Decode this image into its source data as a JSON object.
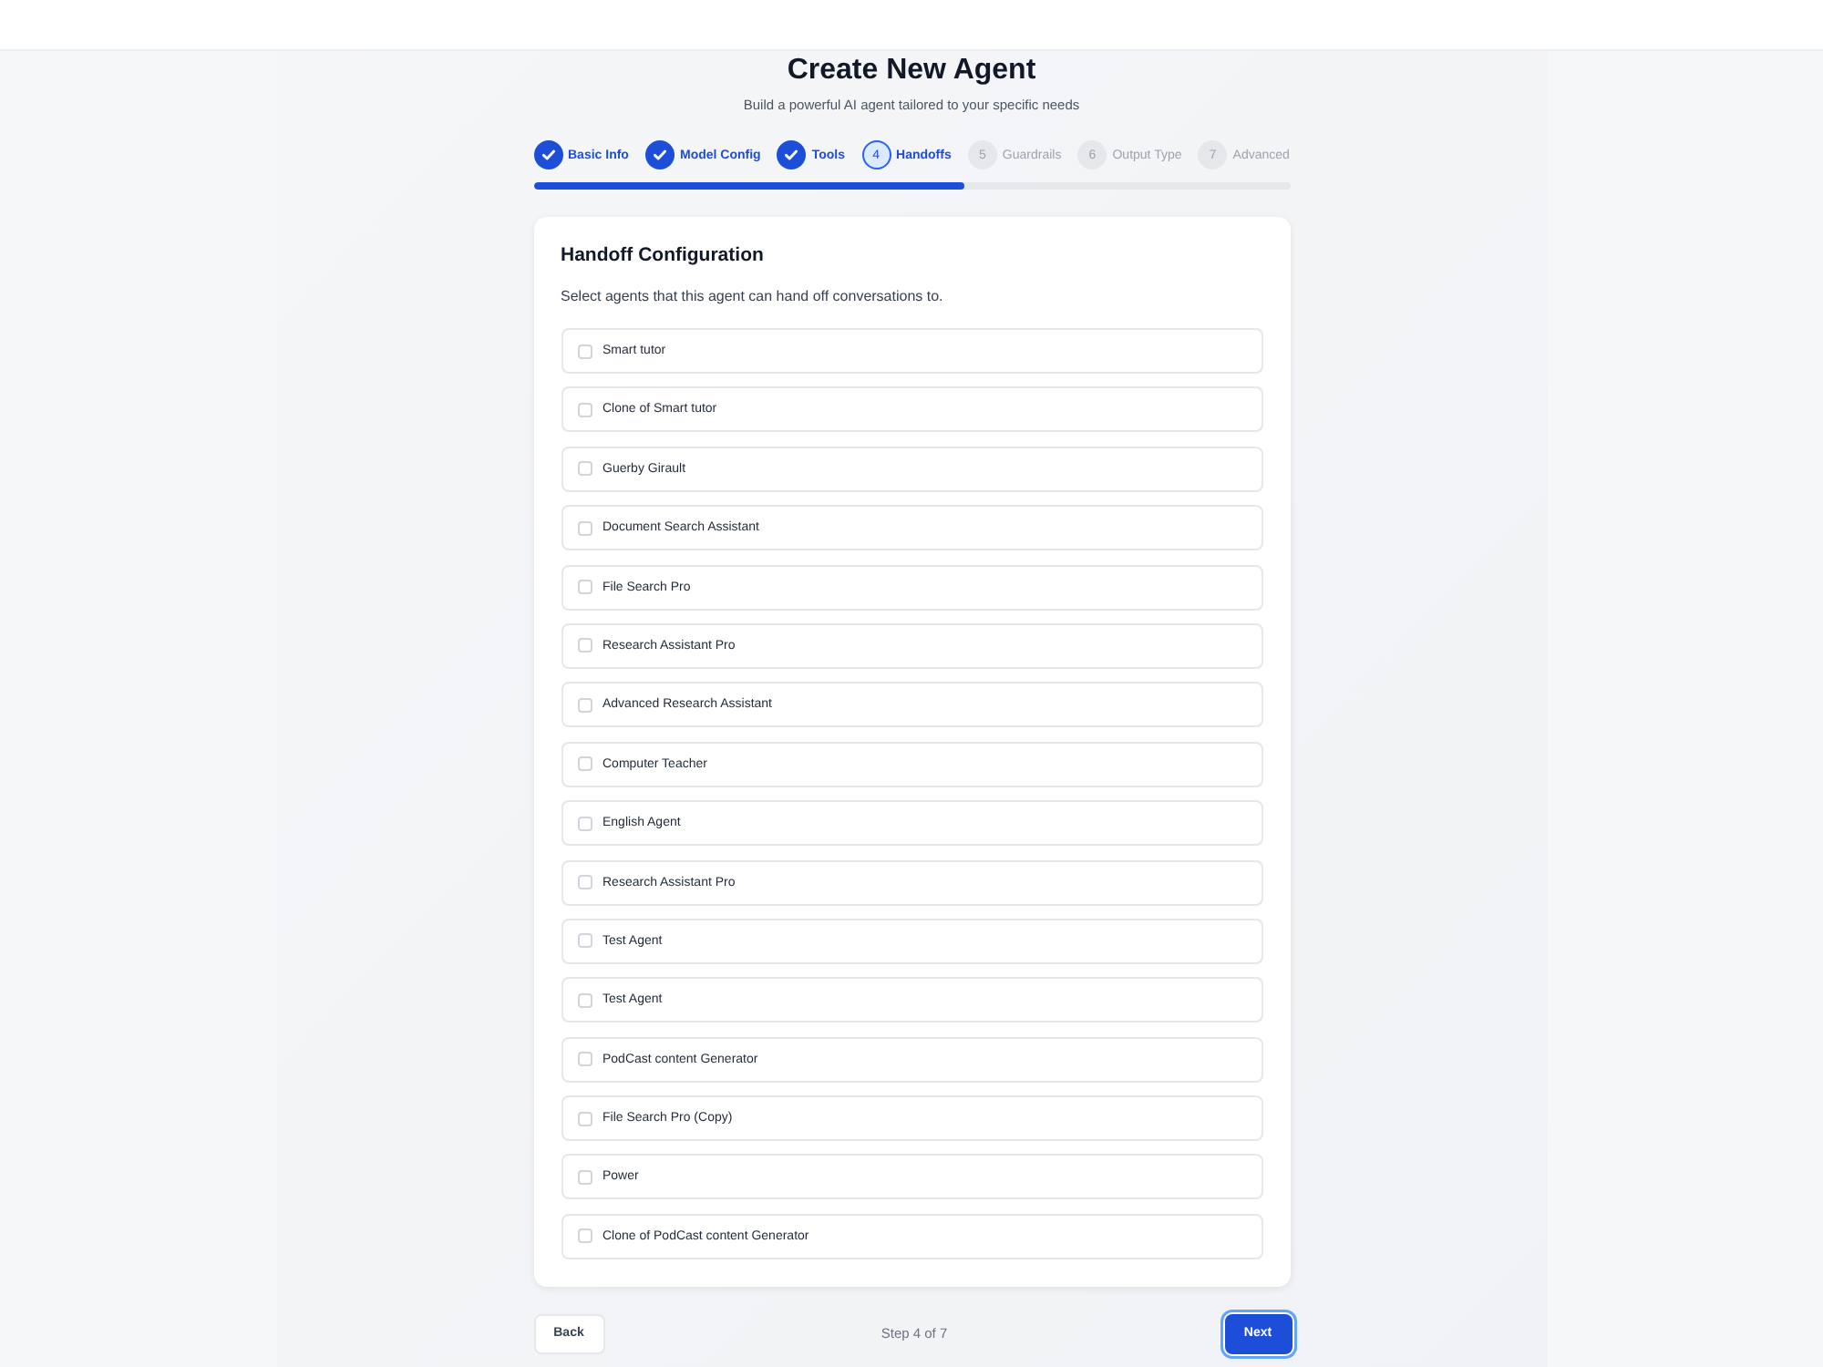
{
  "header": {
    "title": "Create New Agent",
    "subtitle": "Build a powerful AI agent tailored to your specific needs"
  },
  "steps": [
    {
      "label": "Basic Info",
      "completed": true,
      "selected": false
    },
    {
      "label": "Model Config",
      "completed": true,
      "selected": false
    },
    {
      "label": "Tools",
      "completed": true,
      "selected": false
    },
    {
      "number": "4",
      "label": "Handoffs",
      "completed": false,
      "selected": true
    },
    {
      "number": "5",
      "label": "Guardrails",
      "completed": false,
      "selected": false
    },
    {
      "number": "6",
      "label": "Output Type",
      "completed": false,
      "selected": false
    },
    {
      "number": "7",
      "label": "Advanced",
      "completed": false,
      "selected": false
    }
  ],
  "progress": {
    "level": 0.571
  },
  "panel": {
    "title": "Handoff Configuration",
    "description": "Select agents that this agent can hand off conversations to.",
    "agents": [
      {
        "name": "Smart tutor",
        "checked": false
      },
      {
        "name": "Clone of Smart tutor",
        "checked": false
      },
      {
        "name": "Guerby Girault",
        "checked": false
      },
      {
        "name": "Document Search Assistant",
        "checked": false
      },
      {
        "name": "File Search Pro",
        "checked": false
      },
      {
        "name": "Research Assistant Pro",
        "checked": false
      },
      {
        "name": "Advanced Research Assistant",
        "checked": false
      },
      {
        "name": "Computer Teacher",
        "checked": false
      },
      {
        "name": "English Agent",
        "checked": false
      },
      {
        "name": "Research Assistant Pro",
        "checked": false
      },
      {
        "name": "Test Agent",
        "checked": false
      },
      {
        "name": "Test Agent",
        "checked": false
      },
      {
        "name": "PodCast content Generator",
        "checked": false
      },
      {
        "name": "File Search Pro (Copy)",
        "checked": false
      },
      {
        "name": "Power",
        "checked": false
      },
      {
        "name": "Clone of PodCast content Generator",
        "checked": false
      }
    ]
  },
  "footer": {
    "back": "Back",
    "step_text": "Step 4 of 7",
    "next": "Next"
  }
}
